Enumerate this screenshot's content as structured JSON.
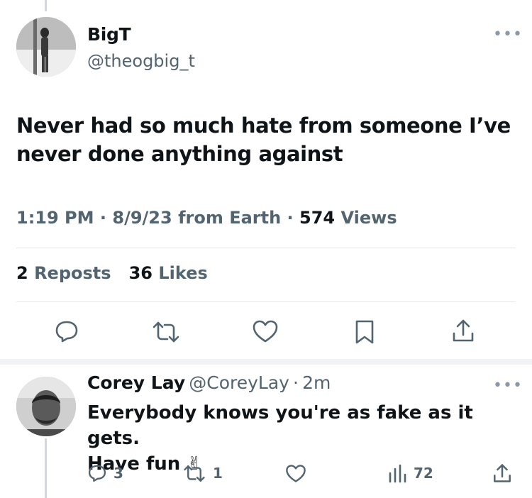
{
  "tweet": {
    "display_name": "BigT",
    "handle": "@theogbig_t",
    "text_line1": "Never had so much hate from someone I’ve",
    "text_line2": "never done anything against",
    "time": "1:19 PM",
    "date": "8/9/23",
    "source": "from Earth",
    "views_count": "574",
    "views_label": "Views",
    "reposts_count": "2",
    "reposts_label": "Reposts",
    "likes_count": "36",
    "likes_label": "Likes",
    "more_label": "•••"
  },
  "reply": {
    "display_name": "Corey Lay",
    "handle": "@CoreyLay",
    "age": "2m",
    "text_line1": "Everybody knows you're as fake as it gets.",
    "text_line2": "Have fun",
    "emoji": "✌",
    "reply_count": "3",
    "repost_count": "1",
    "views_count": "72",
    "more_label": "•••"
  },
  "icons": {
    "reply": "reply-icon",
    "repost": "repost-icon",
    "like": "heart-icon",
    "bookmark": "bookmark-icon",
    "share": "share-icon",
    "views": "analytics-icon"
  },
  "colors": {
    "text": "#0f1419",
    "secondary": "#536471",
    "divider": "#e1e6ea"
  }
}
